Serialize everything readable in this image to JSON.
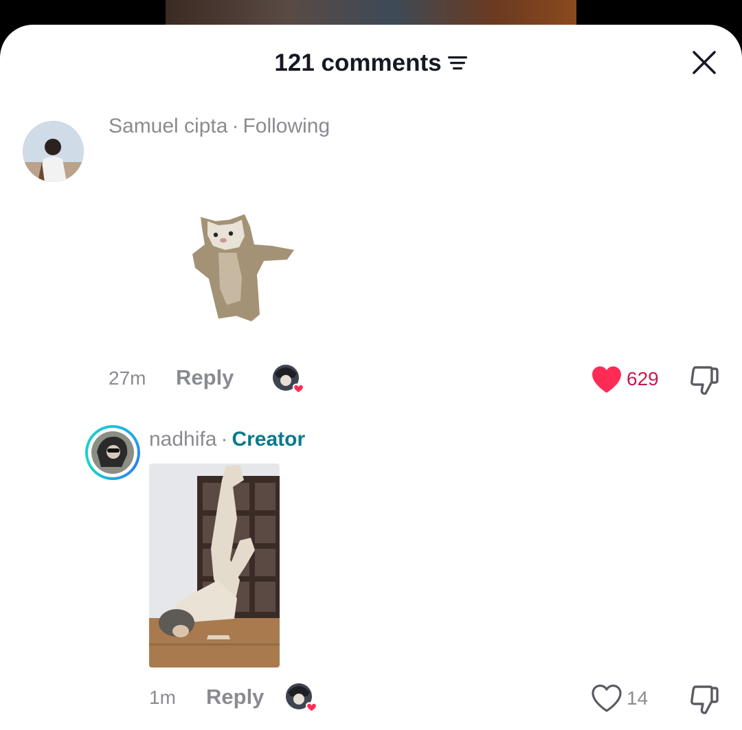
{
  "header": {
    "title": "121 comments"
  },
  "comments": [
    {
      "username": "Samuel cipta",
      "relation": "Following",
      "time": "27m",
      "reply_label": "Reply",
      "likes": "629",
      "liked": true
    }
  ],
  "reply": {
    "username": "nadhifa",
    "relation": "Creator",
    "time": "1m",
    "reply_label": "Reply",
    "likes": "14",
    "liked": false
  },
  "colors": {
    "like_red": "#fe2c55",
    "creator_teal": "#0b7a8a",
    "muted": "#8a8b91"
  },
  "icons": [
    "filter-icon",
    "close-icon",
    "heart-icon",
    "dislike-icon"
  ]
}
